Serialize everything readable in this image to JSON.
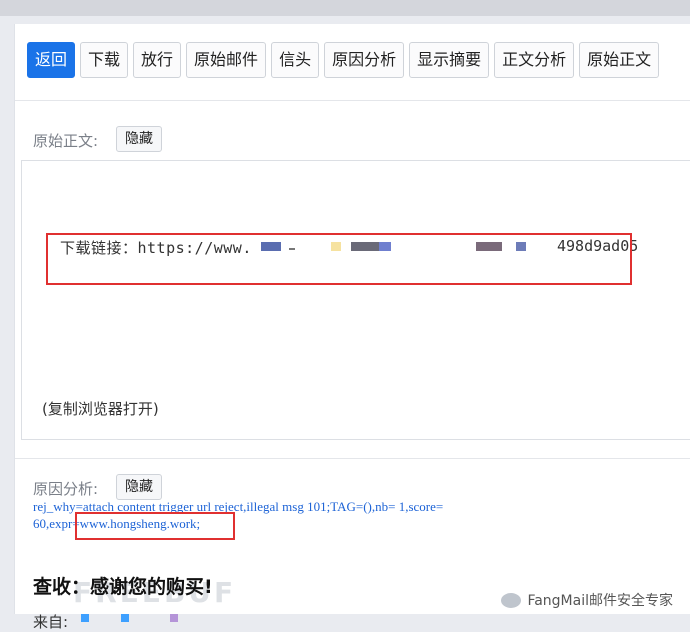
{
  "toolbar": {
    "buttons": [
      "返回",
      "下载",
      "放行",
      "原始邮件",
      "信头",
      "原因分析",
      "显示摘要",
      "正文分析",
      "原始正文"
    ]
  },
  "original_body": {
    "label": "原始正文:",
    "toggle": "隐藏",
    "link_prefix": "下载链接：https://www.",
    "link_suffix": "498d9ad05",
    "note": "(复制浏览器打开)"
  },
  "reason": {
    "label": "原因分析:",
    "toggle": "隐藏",
    "line1": "rej_why=attach content trigger url reject,illegal msg 101;TAG=(),nb=  1,score=",
    "line2": "60,expr=www.hongsheng.work;"
  },
  "content": {
    "headline": "查收：感谢您的购买!",
    "from_label": "来自:"
  },
  "watermark": {
    "faint": "FREEBUF",
    "brand": "FangMail邮件安全专家"
  },
  "colors": {
    "primary": "#1a73e8",
    "highlight_box": "#e03030",
    "reason_text": "#1d63d6"
  }
}
